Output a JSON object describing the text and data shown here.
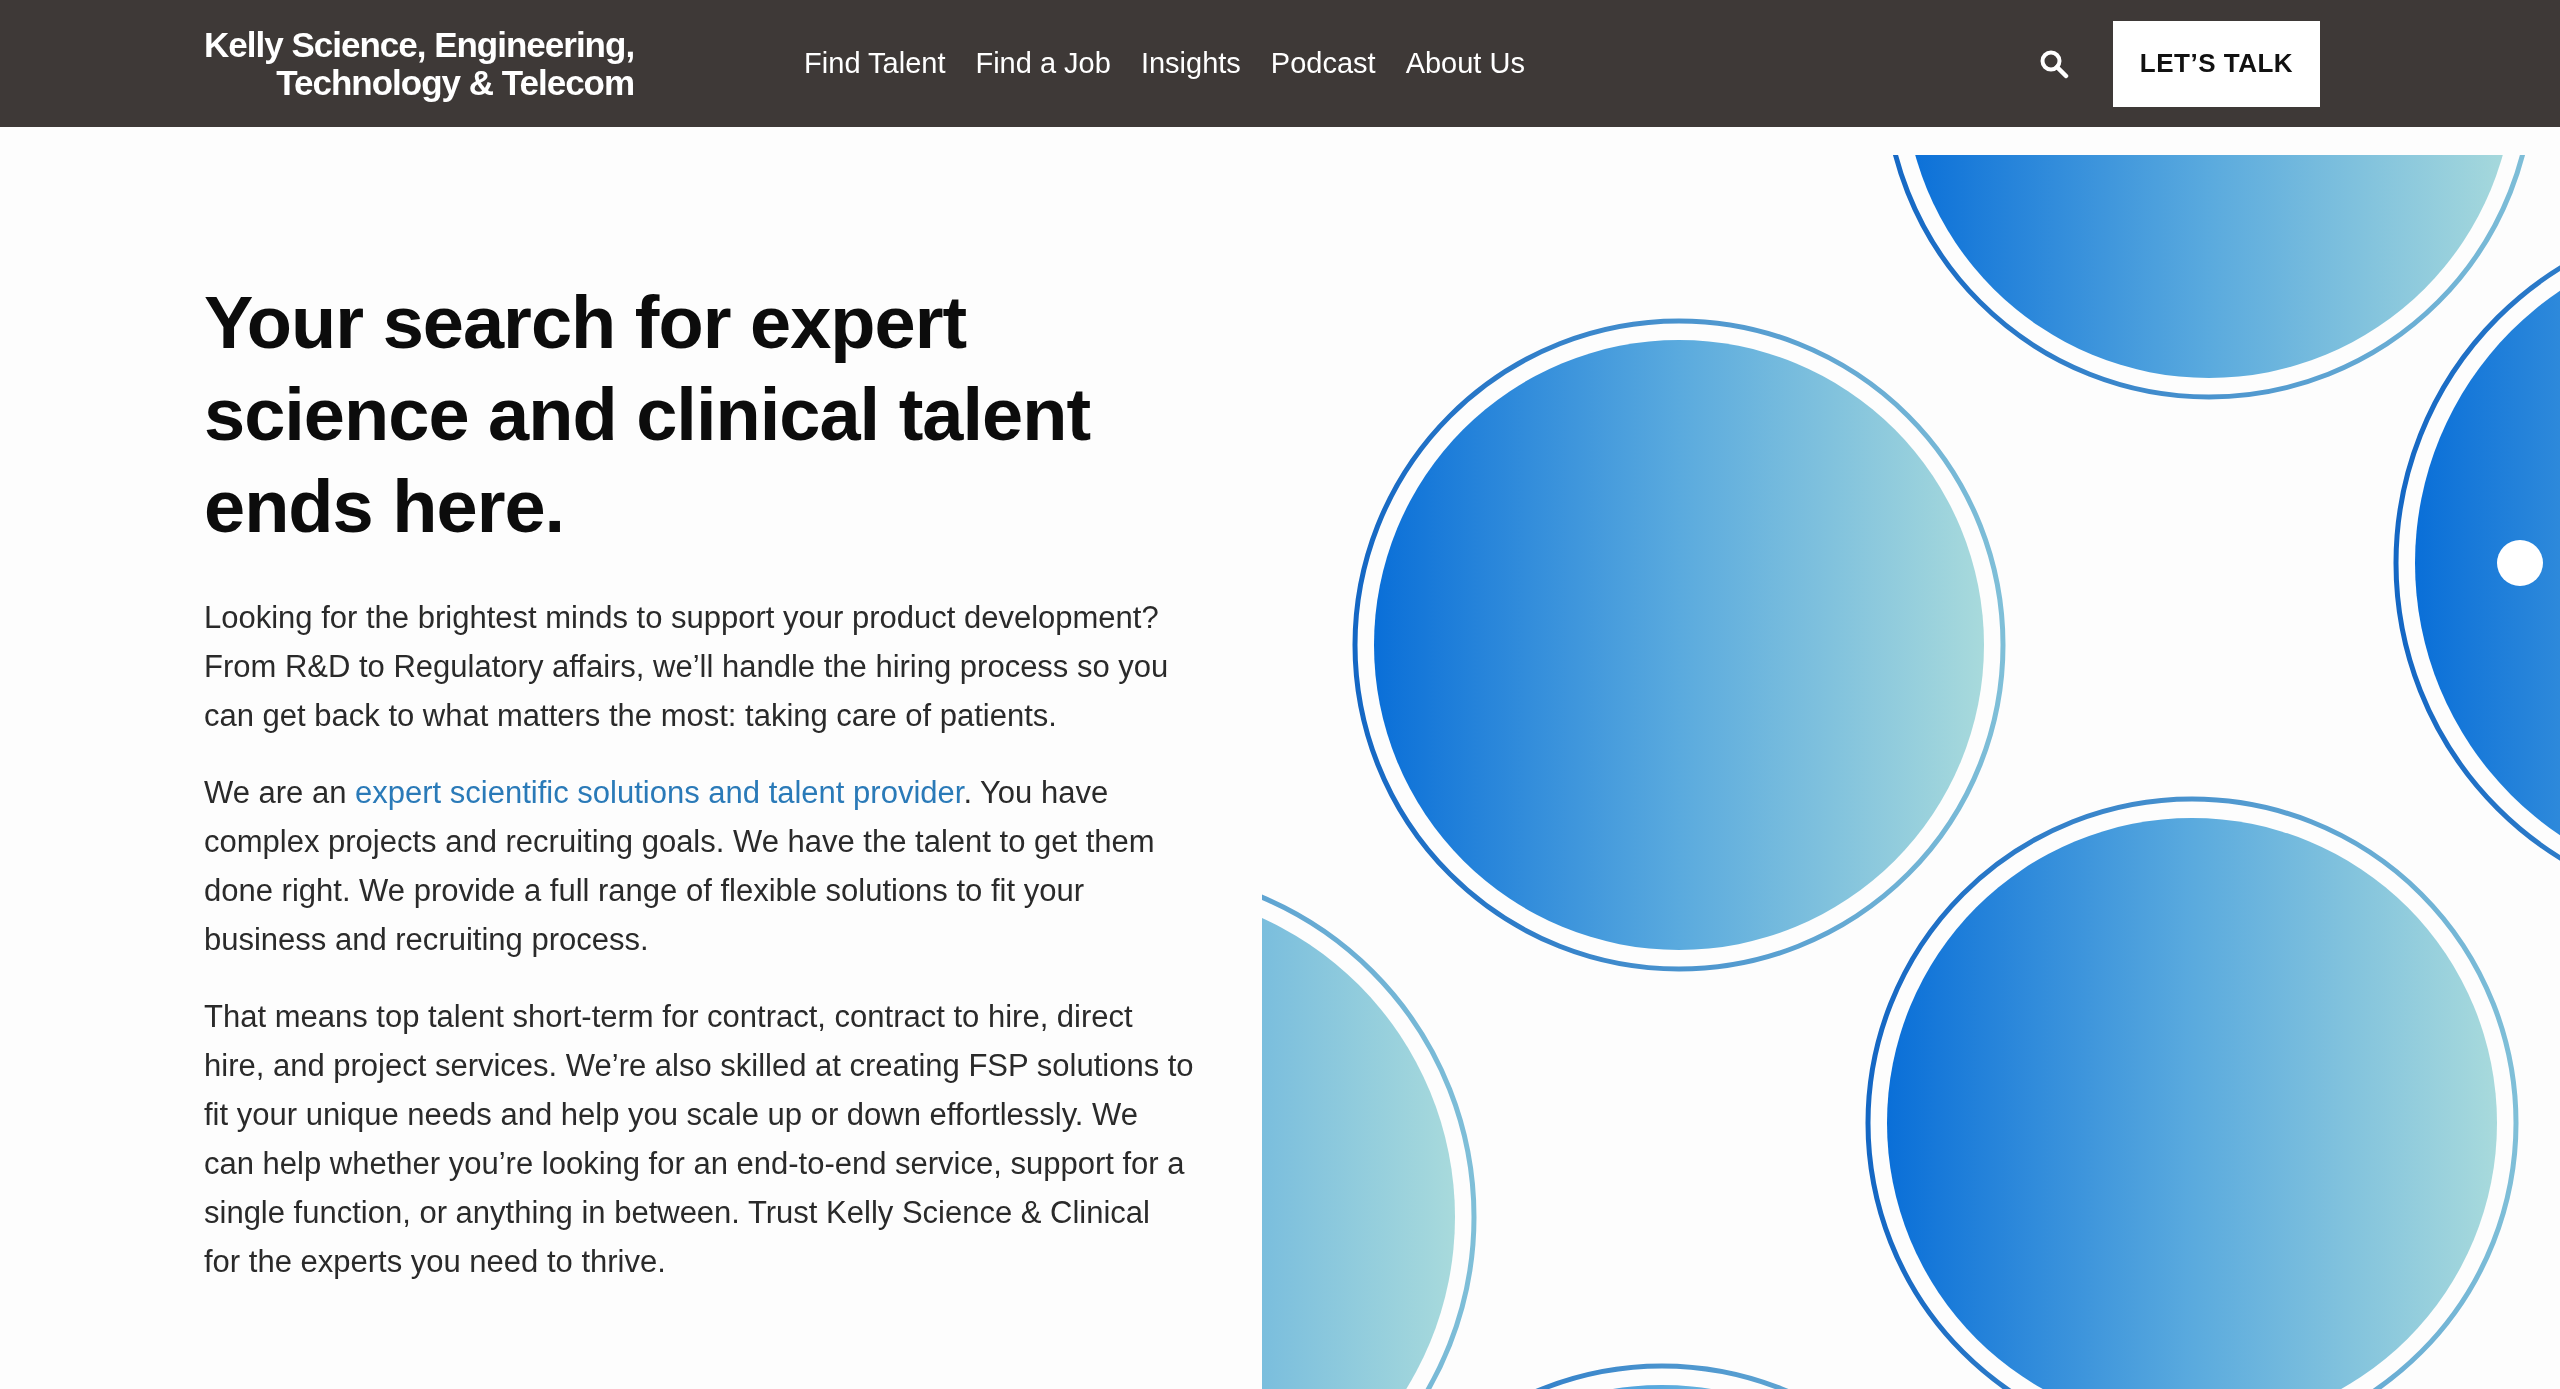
{
  "header": {
    "logo_lines": [
      "Kelly Science, Engineering,",
      "Technology & Telecom"
    ],
    "nav": [
      {
        "label": "Find Talent"
      },
      {
        "label": "Find a Job"
      },
      {
        "label": "Insights"
      },
      {
        "label": "Podcast"
      },
      {
        "label": "About Us"
      }
    ],
    "cta": "LET’S TALK"
  },
  "hero": {
    "heading": "Your search for expert science and clinical talent ends here.",
    "paragraphs": [
      {
        "text": "Looking for the brightest minds to support your product development? From R&D to Regulatory affairs, we’ll handle the hiring process so you can get back to what matters the most: taking care of patients."
      },
      {
        "before": "We are an ",
        "link": "expert scientific solutions and talent provider",
        "after": ". You have complex projects and recruiting goals. We have the talent to get them done right. We provide a full range of flexible solutions to fit your business and recruiting process."
      },
      {
        "text": "That means top talent short-term for contract, contract to hire, direct hire, and project services. We’re also skilled at creating FSP solutions to fit your unique needs and help you scale up or down effortlessly. We can help whether you’re looking for an end-to-end service, support for a single function, or anything in between. Trust Kelly Science & Clinical for the experts you need to thrive."
      }
    ]
  }
}
